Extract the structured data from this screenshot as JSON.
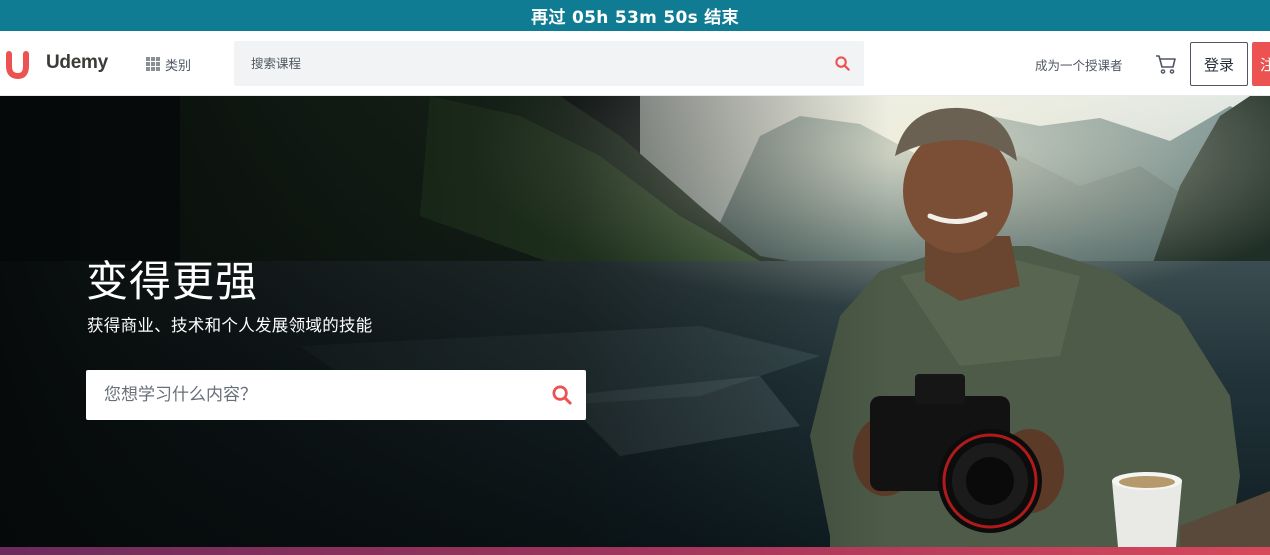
{
  "promo": {
    "countdown": "再过 05h 53m 50s 结束"
  },
  "header": {
    "logo_text": "Udemy",
    "categories_label": "类别",
    "search_placeholder": "搜索课程",
    "teach_label": "成为一个授课者",
    "login_label": "登录",
    "signup_label": "注"
  },
  "hero": {
    "title": "变得更强",
    "subtitle": "获得商业、技术和个人发展领域的技能",
    "search_placeholder": "您想学习什么内容？"
  },
  "colors": {
    "promo_bg": "#0f7c94",
    "brand_red": "#ec5252",
    "text_dark": "#29303b"
  },
  "icons": [
    "udemy-logo-icon",
    "grid-icon",
    "search-icon",
    "cart-icon"
  ]
}
